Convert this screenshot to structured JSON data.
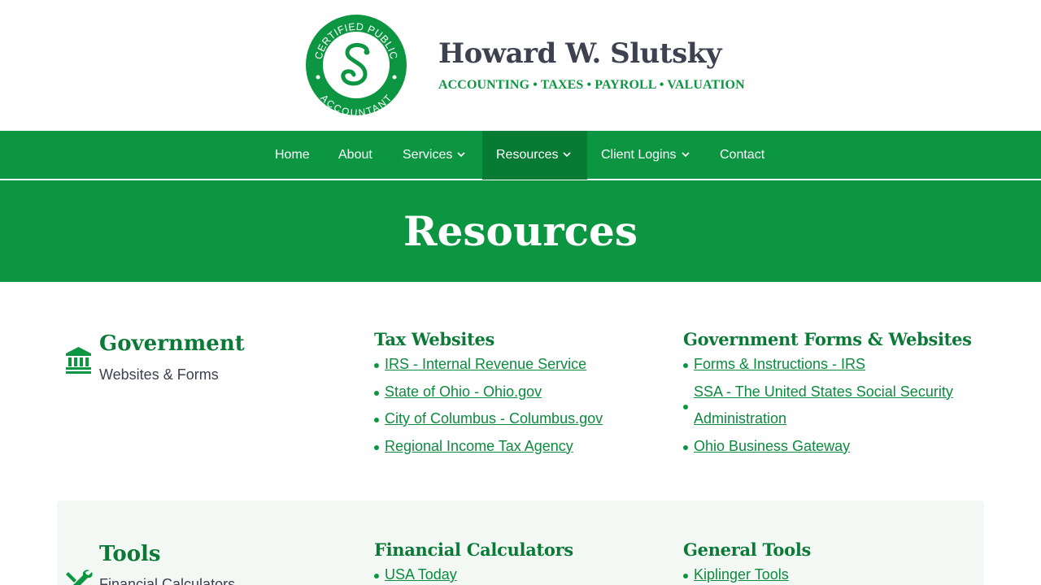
{
  "header": {
    "logo_text_top": "CERTIFIED PUBLIC",
    "logo_text_bottom": "ACCOUNTANT",
    "logo_letter": "S",
    "brand_name": "Howard W. Slutsky",
    "tagline": "ACCOUNTING • TAXES • PAYROLL • VALUATION"
  },
  "nav": {
    "items": [
      {
        "label": "Home"
      },
      {
        "label": "About"
      },
      {
        "label": "Services"
      },
      {
        "label": "Resources"
      },
      {
        "label": "Client Logins"
      },
      {
        "label": "Contact"
      }
    ],
    "dropdown_glyph": "⌄"
  },
  "hero": {
    "title": "Resources"
  },
  "government": {
    "icon": "bank-icon",
    "title": "Government",
    "subtitle": "Websites & Forms",
    "tax_websites": {
      "title": "Tax Websites",
      "links": [
        "IRS - Internal Revenue Service",
        "State of Ohio - Ohio.gov",
        "City of Columbus - Columbus.gov",
        "Regional Income Tax Agency"
      ]
    },
    "forms_websites": {
      "title": "Government Forms & Websites",
      "links": [
        "Forms & Instructions - IRS",
        "SSA - The United States Social Security Administration",
        "Ohio Business Gateway"
      ]
    }
  },
  "tools": {
    "icon": "tools-icon",
    "title": "Tools",
    "subtitle": "Financial Calculators",
    "financial_calculators": {
      "title": "Financial Calculators",
      "links": [
        "USA Today"
      ]
    },
    "general_tools": {
      "title": "General Tools",
      "links": [
        "Kiplinger Tools"
      ]
    }
  },
  "colors": {
    "brand_green": "#0c9642",
    "dark_green": "#0b7a36",
    "active_nav": "#077a33",
    "heading_gray": "#3d4150"
  }
}
